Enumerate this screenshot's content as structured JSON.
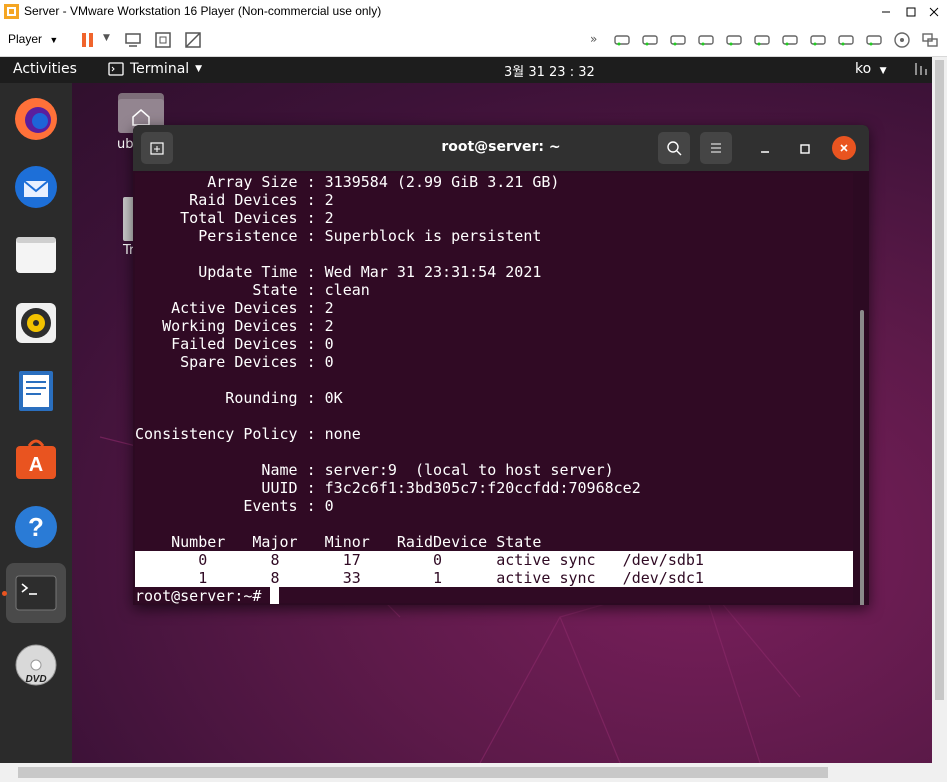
{
  "vmware": {
    "title": "Server - VMware Workstation 16 Player (Non-commercial use only)",
    "player_menu": "Player",
    "window_buttons": [
      "minimize",
      "maximize",
      "close"
    ]
  },
  "ubuntu": {
    "activities": "Activities",
    "app_menu": "Terminal",
    "clock": "3월 31  23 : 32",
    "lang": "ko",
    "desktop_icons": [
      {
        "label": "ub",
        "icon": "home-folder-icon"
      },
      {
        "label": "Tr",
        "icon": "trash-icon"
      }
    ],
    "dock": [
      {
        "name": "firefox",
        "icon": "firefox-icon"
      },
      {
        "name": "thunderbird",
        "icon": "thunderbird-icon"
      },
      {
        "name": "files",
        "icon": "files-icon"
      },
      {
        "name": "rhythmbox",
        "icon": "rhythmbox-icon"
      },
      {
        "name": "writer",
        "icon": "writer-icon"
      },
      {
        "name": "software",
        "icon": "software-icon"
      },
      {
        "name": "help",
        "icon": "help-icon"
      },
      {
        "name": "terminal",
        "icon": "terminal-icon",
        "active": true
      },
      {
        "name": "dvd",
        "icon": "dvd-icon"
      }
    ]
  },
  "terminal": {
    "title": "root@server: ~",
    "lines": [
      "        Array Size : 3139584 (2.99 GiB 3.21 GB)",
      "      Raid Devices : 2",
      "     Total Devices : 2",
      "       Persistence : Superblock is persistent",
      "",
      "       Update Time : Wed Mar 31 23:31:54 2021",
      "             State : clean",
      "    Active Devices : 2",
      "   Working Devices : 2",
      "    Failed Devices : 0",
      "     Spare Devices : 0",
      "",
      "          Rounding : 0K",
      "",
      "Consistency Policy : none",
      "",
      "              Name : server:9  (local to host server)",
      "              UUID : f3c2c6f1:3bd305c7:f20ccfdd:70968ce2",
      "            Events : 0",
      "",
      "    Number   Major   Minor   RaidDevice State",
      "       0       8       17        0      active sync   /dev/sdb1",
      "       1       8       33        1      active sync   /dev/sdc1"
    ],
    "prompt": "root@server:~# "
  }
}
